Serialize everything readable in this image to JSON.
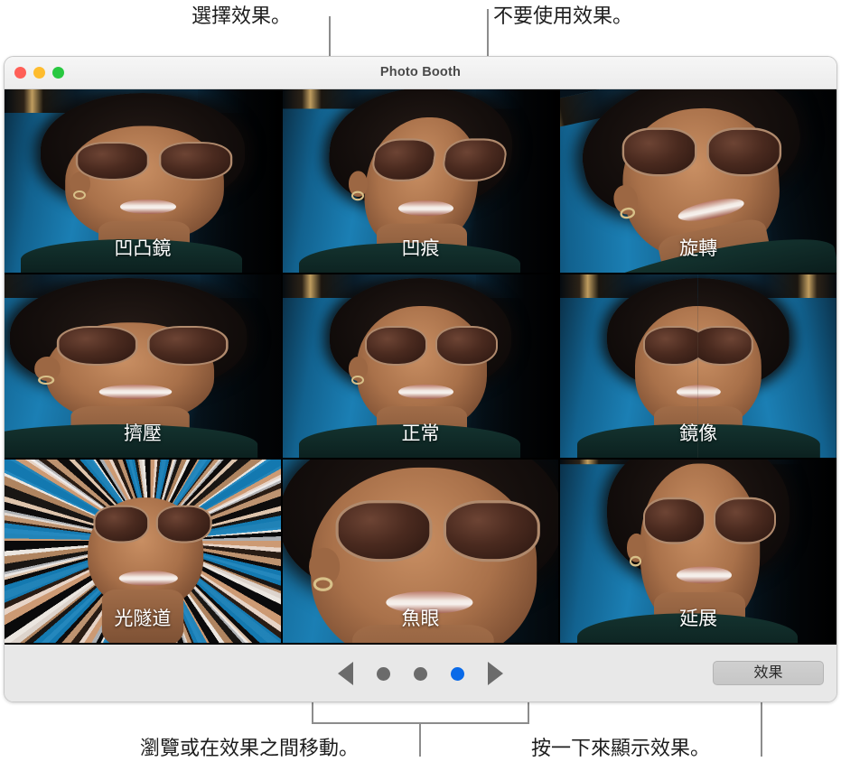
{
  "window": {
    "title": "Photo Booth",
    "traffic_lights": [
      {
        "name": "close-button",
        "color": "#ff5f57"
      },
      {
        "name": "minimize-button",
        "color": "#febc2e"
      },
      {
        "name": "zoom-button",
        "color": "#28c840"
      }
    ]
  },
  "effects_grid": {
    "cells": [
      {
        "label": "凹凸鏡",
        "fx": "fx-bump",
        "selected": false
      },
      {
        "label": "凹痕",
        "fx": "fx-dent",
        "selected": false
      },
      {
        "label": "旋轉",
        "fx": "fx-twirl",
        "selected": false
      },
      {
        "label": "擠壓",
        "fx": "fx-squeeze",
        "selected": false
      },
      {
        "label": "正常",
        "fx": "fx-normal",
        "selected": true
      },
      {
        "label": "鏡像",
        "fx": "fx-mirror",
        "selected": false
      },
      {
        "label": "光隧道",
        "fx": "fx-tunnel",
        "selected": false
      },
      {
        "label": "魚眼",
        "fx": "fx-fisheye",
        "selected": false
      },
      {
        "label": "延展",
        "fx": "fx-stretch",
        "selected": false
      }
    ]
  },
  "toolbar": {
    "previous_page_icon": "triangle-left-icon",
    "next_page_icon": "triangle-right-icon",
    "page_dots": [
      {
        "active": false
      },
      {
        "active": false
      },
      {
        "active": true
      }
    ],
    "effects_button_label": "效果",
    "active_page": 3,
    "total_pages": 3
  },
  "callouts": {
    "top_left": "選擇效果。",
    "top_right": "不要使用效果。",
    "bottom_left": "瀏覽或在效果之間移動。",
    "bottom_right": "按一下來顯示效果。"
  },
  "colors": {
    "accent_blue": "#0a6ae8",
    "leader_line": "#8c8c8c",
    "toolbar_bg": "#e8e8e8",
    "titlebar_bg": "#f0f0f0"
  }
}
